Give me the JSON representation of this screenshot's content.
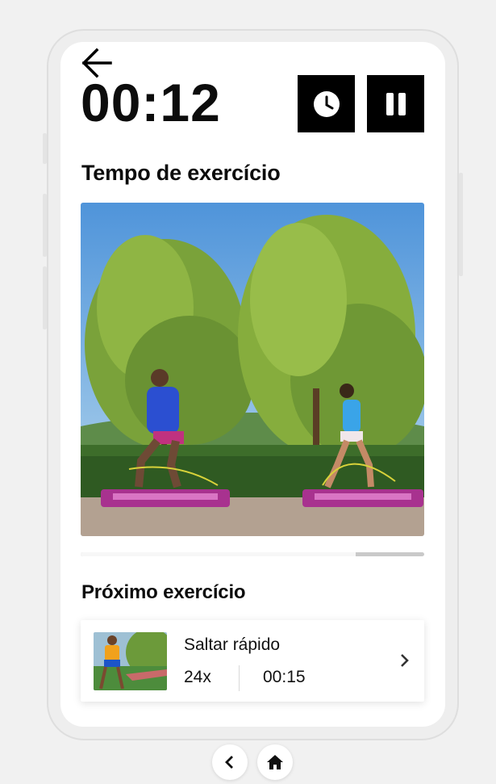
{
  "workout": {
    "timer": "00:12",
    "current_title": "Tempo de exercício",
    "progress_fraction": 0.8
  },
  "next": {
    "section_title": "Próximo exercício",
    "name": "Saltar rápido",
    "reps": "24x",
    "duration": "00:15"
  },
  "icons": {
    "back": "arrow-left-icon",
    "clock": "clock-icon",
    "pause": "pause-icon",
    "chevron": "chevron-right-icon",
    "nav_back": "chevron-left-icon",
    "nav_home": "home-icon"
  },
  "colors": {
    "accent": "#000000",
    "progress_track": "#c9c9c9",
    "progress_fill": "#f7f7f7"
  }
}
